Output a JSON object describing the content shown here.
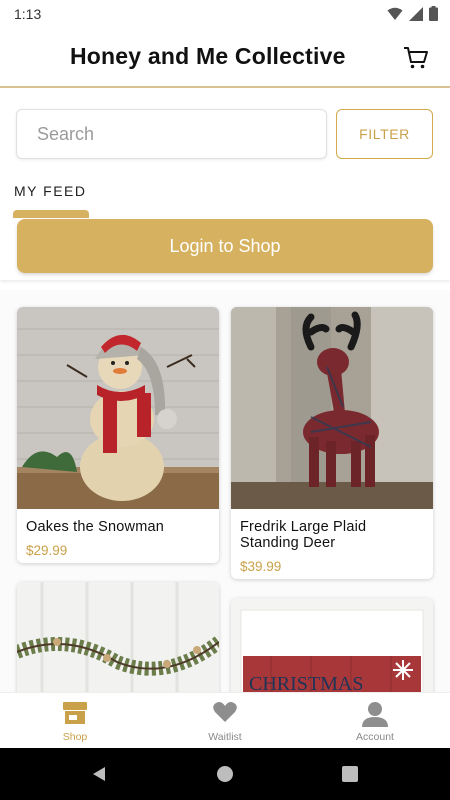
{
  "status_bar": {
    "time": "1:13"
  },
  "header": {
    "title": "Honey and Me Collective",
    "cart_icon": "cart-icon"
  },
  "search": {
    "placeholder": "Search",
    "value": "",
    "filter_label": "FILTER"
  },
  "feed": {
    "label": "MY FEED",
    "login_label": "Login to Shop"
  },
  "products": [
    {
      "name": "Oakes the Snowman",
      "price": "$29.99"
    },
    {
      "name": "Fredrik Large Plaid Standing Deer",
      "price": "$39.99"
    },
    {
      "name": "",
      "price": ""
    },
    {
      "name": "",
      "price": "",
      "image_text": "CHRISTMAS"
    }
  ],
  "bottom_nav": [
    {
      "label": "Shop",
      "icon": "shop-icon",
      "active": true
    },
    {
      "label": "Waitlist",
      "icon": "heart-icon",
      "active": false
    },
    {
      "label": "Account",
      "icon": "account-icon",
      "active": false
    }
  ],
  "colors": {
    "accent": "#d6b160",
    "price": "#c9a14a",
    "header_border": "#d8c193"
  }
}
